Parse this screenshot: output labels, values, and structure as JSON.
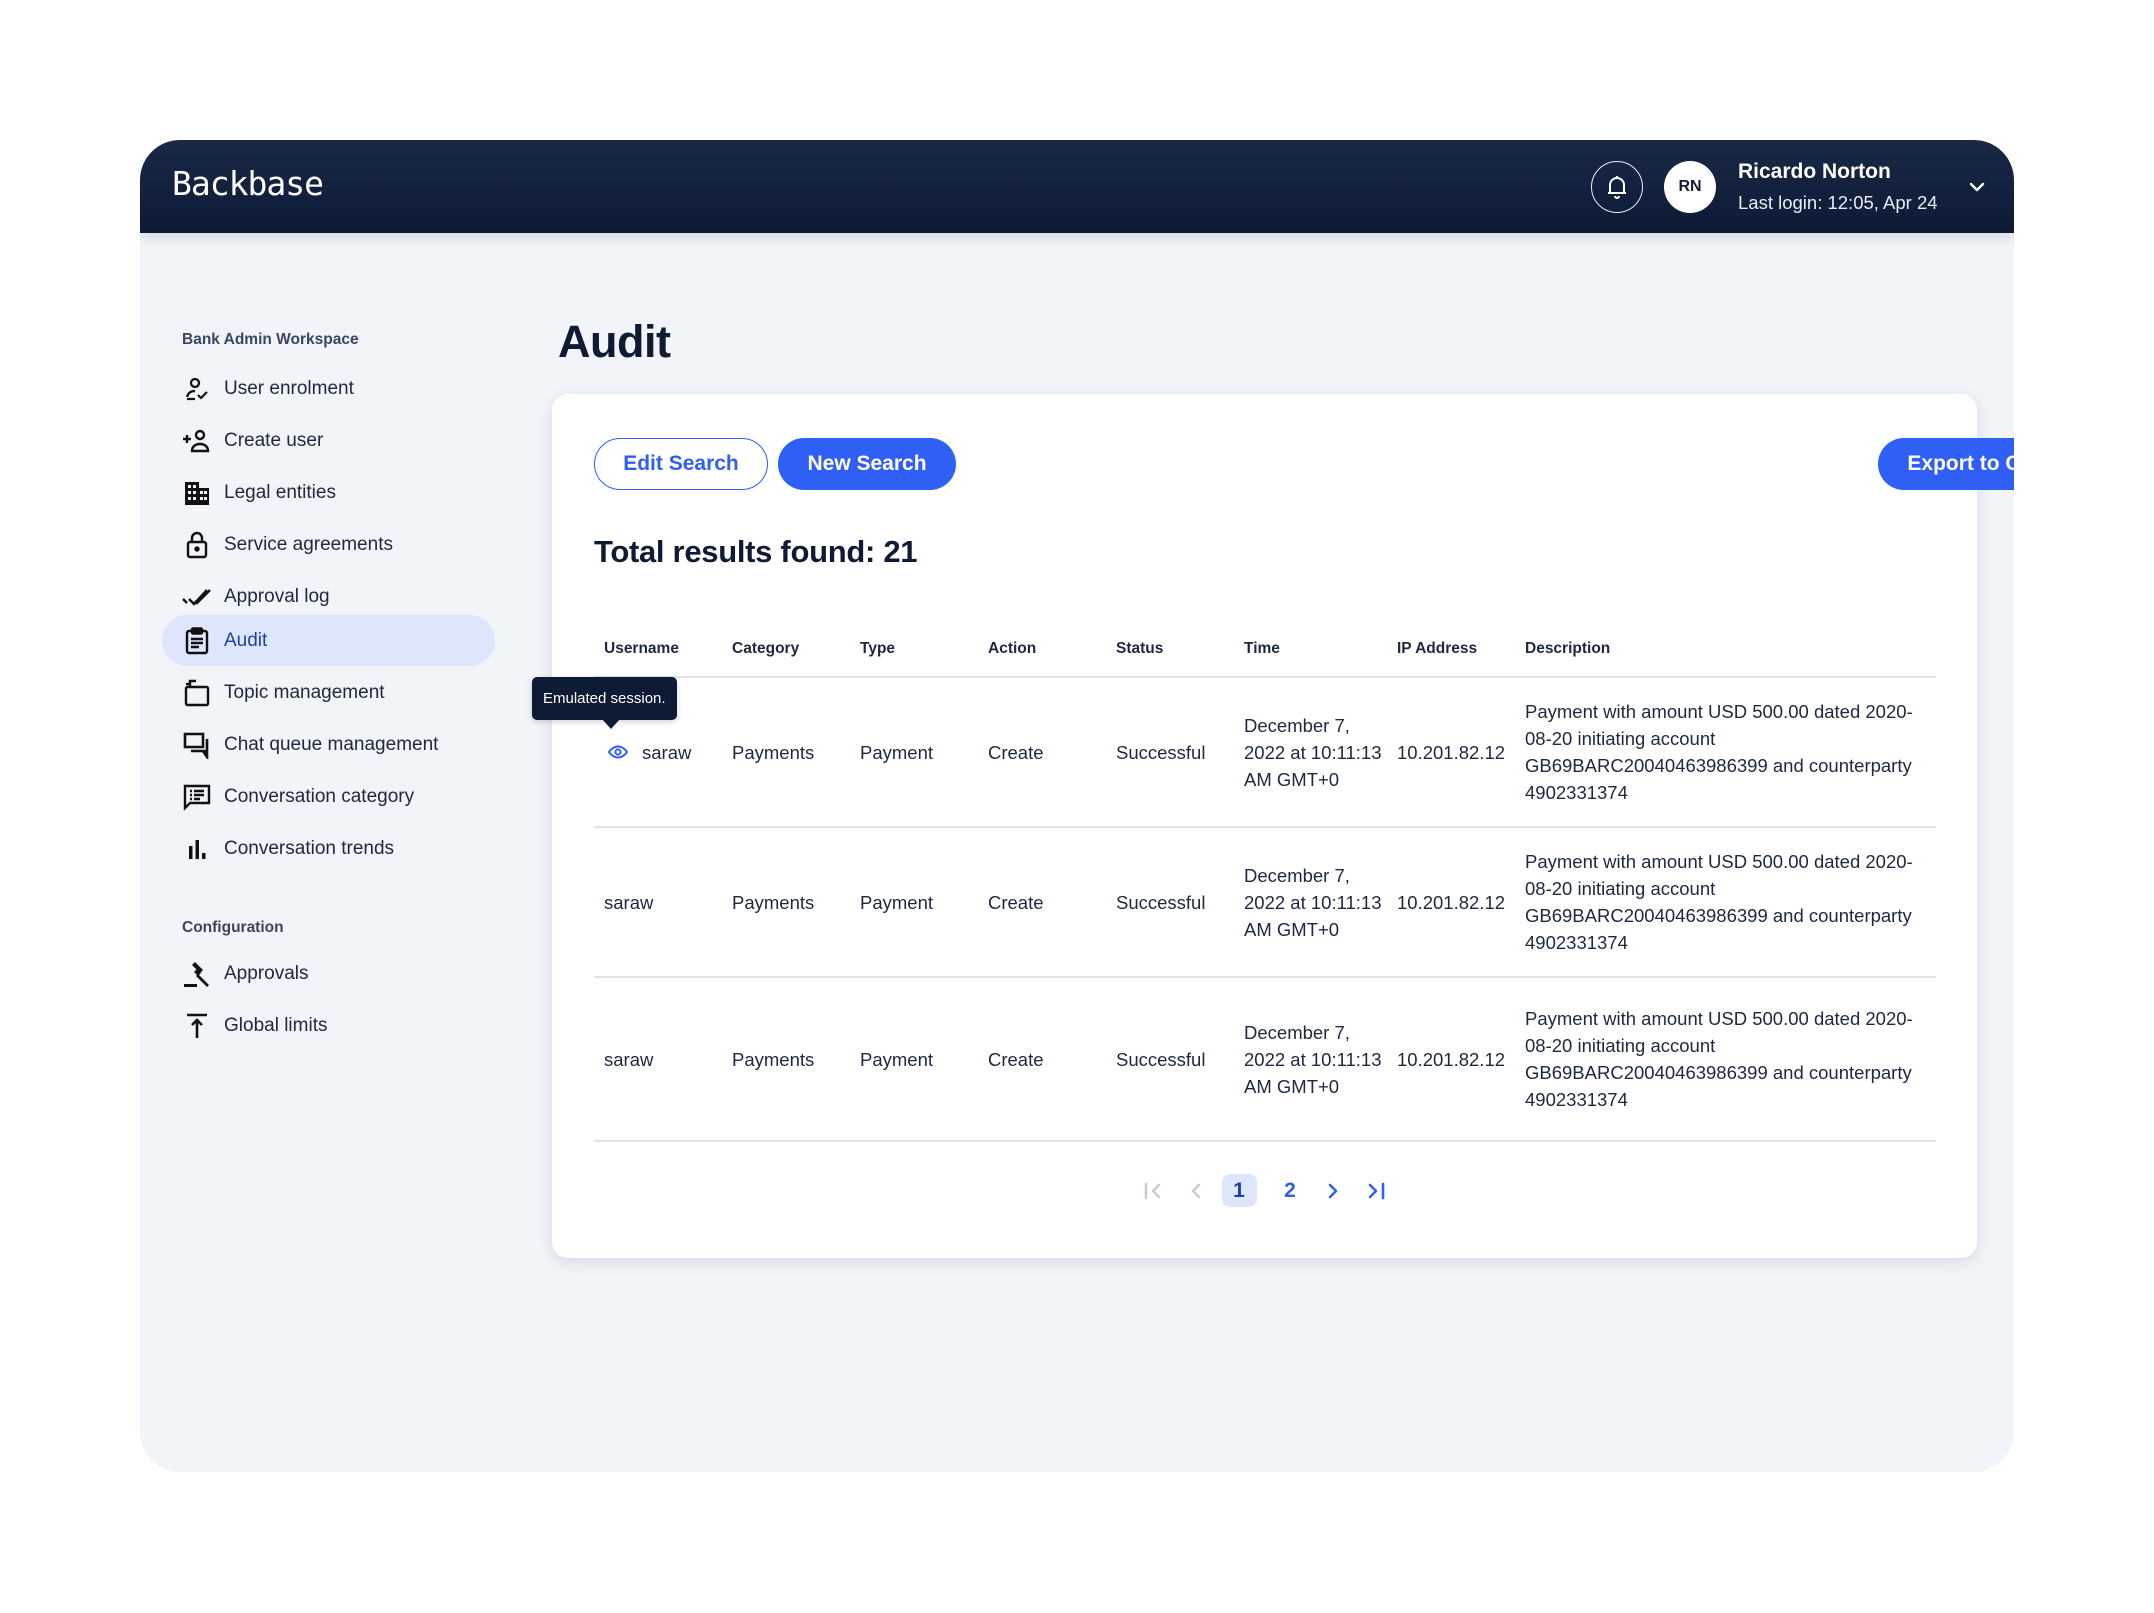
{
  "header": {
    "logo": "Backbase",
    "notifications_icon": "bell-icon",
    "user": {
      "initials": "RN",
      "name": "Ricardo Norton",
      "last_login": "Last login: 12:05, Apr 24"
    }
  },
  "sidebar": {
    "sections": [
      {
        "title": "Bank Admin Workspace",
        "items": [
          {
            "label": "User enrolment",
            "icon": "user-check-icon"
          },
          {
            "label": "Create user",
            "icon": "add-user-icon"
          },
          {
            "label": "Legal entities",
            "icon": "building-icon"
          },
          {
            "label": "Service agreements",
            "icon": "lock-icon"
          },
          {
            "label": "Approval log",
            "icon": "double-check-icon"
          },
          {
            "label": "Audit",
            "icon": "clipboard-icon",
            "active": true
          },
          {
            "label": "Topic management",
            "icon": "topic-icon"
          },
          {
            "label": "Chat queue management",
            "icon": "chat-queue-icon"
          },
          {
            "label": "Conversation category",
            "icon": "chat-list-icon"
          },
          {
            "label": "Conversation trends",
            "icon": "bar-chart-icon"
          }
        ]
      },
      {
        "title": "Configuration",
        "items": [
          {
            "label": "Approvals",
            "icon": "gavel-icon"
          },
          {
            "label": "Global limits",
            "icon": "upload-limit-icon"
          }
        ]
      }
    ]
  },
  "main": {
    "title": "Audit",
    "buttons": {
      "edit_search": "Edit Search",
      "new_search": "New Search",
      "export": "Export to CSV"
    },
    "total_results": "Total results found: 21",
    "table": {
      "columns": [
        "Username",
        "Category",
        "Type",
        "Action",
        "Status",
        "Time",
        "IP Address",
        "Description"
      ],
      "rows": [
        {
          "username": "saraw",
          "emulated": true,
          "tooltip": "Emulated session.",
          "category": "Payments",
          "type": "Payment",
          "action": "Create",
          "status": "Successful",
          "time": "December 7, 2022 at 10:11:13 AM GMT+0",
          "ip": "10.201.82.12",
          "description": "Payment with amount USD 500.00 dated 2020-08-20 initiating account GB69BARC20040463986399 and counterparty 4902331374"
        },
        {
          "username": "saraw",
          "emulated": false,
          "category": "Payments",
          "type": "Payment",
          "action": "Create",
          "status": "Successful",
          "time": "December 7, 2022 at 10:11:13 AM GMT+0",
          "ip": "10.201.82.12",
          "description": "Payment with amount USD 500.00 dated 2020-08-20 initiating account GB69BARC20040463986399 and counterparty 4902331374"
        },
        {
          "username": "saraw",
          "emulated": false,
          "category": "Payments",
          "type": "Payment",
          "action": "Create",
          "status": "Successful",
          "time": "December 7, 2022 at 10:11:13 AM GMT+0",
          "ip": "10.201.82.12",
          "description": "Payment with amount USD 500.00 dated 2020-08-20 initiating account GB69BARC20040463986399 and counterparty 4902331374"
        }
      ]
    },
    "pagination": {
      "pages": [
        "1",
        "2"
      ],
      "current": "1"
    }
  },
  "colors": {
    "primary": "#2f5ff5",
    "header_bg": "#0c1a36",
    "active_bg": "#dde6fc",
    "page_bg": "#f1f4f8"
  }
}
